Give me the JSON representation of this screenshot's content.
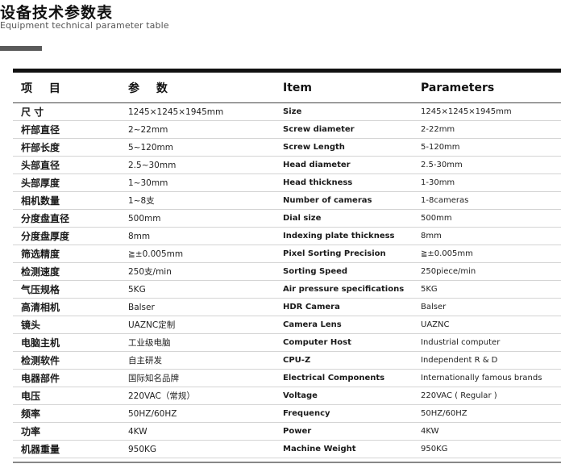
{
  "header": {
    "title_cn": "设备技术参数表",
    "title_en": "Equipment technical parameter table"
  },
  "table": {
    "columns": [
      "项 目",
      "参 数",
      "Item",
      "Parameters"
    ],
    "rows": [
      [
        "尺 寸",
        "1245×1245×1945mm",
        "Size",
        "1245×1245×1945mm"
      ],
      [
        "杆部直径",
        "2~22mm",
        "Screw diameter",
        "2-22mm"
      ],
      [
        "杆部长度",
        "5~120mm",
        "Screw Length",
        "5-120mm"
      ],
      [
        "头部直径",
        "2.5~30mm",
        "Head diameter",
        "2.5-30mm"
      ],
      [
        "头部厚度",
        "1~30mm",
        "Head thickness",
        "1-30mm"
      ],
      [
        "相机数量",
        "1~8支",
        "Number of cameras",
        "1-8cameras"
      ],
      [
        "分度盘直径",
        "500mm",
        "Dial size",
        "500mm"
      ],
      [
        "分度盘厚度",
        "8mm",
        "Indexing plate thickness",
        "8mm"
      ],
      [
        "筛选精度",
        "≧±0.005mm",
        "Pixel Sorting Precision",
        "≧±0.005mm"
      ],
      [
        "检测速度",
        "250支/min",
        "Sorting Speed",
        "250piece/min"
      ],
      [
        "气压规格",
        "5KG",
        "Air pressure specifications",
        "5KG"
      ],
      [
        "高清相机",
        "Balser",
        "HDR Camera",
        "Balser"
      ],
      [
        "镜头",
        "UAZNC定制",
        "Camera Lens",
        "UAZNC"
      ],
      [
        "电脑主机",
        "工业级电脑",
        "Computer Host",
        "Industrial computer"
      ],
      [
        "检测软件",
        "自主研发",
        "CPU-Z",
        "Independent R & D"
      ],
      [
        "电器部件",
        "国际知名品牌",
        "Electrical Components",
        "Internationally famous brands"
      ],
      [
        "电压",
        "220VAC（常规）",
        "Voltage",
        "220VAC ( Regular )"
      ],
      [
        "频率",
        "50HZ/60HZ",
        "Frequency",
        "50HZ/60HZ"
      ],
      [
        "功率",
        "4KW",
        "Power",
        "4KW"
      ],
      [
        "机器重量",
        "950KG",
        "Machine Weight",
        "950KG"
      ]
    ]
  }
}
